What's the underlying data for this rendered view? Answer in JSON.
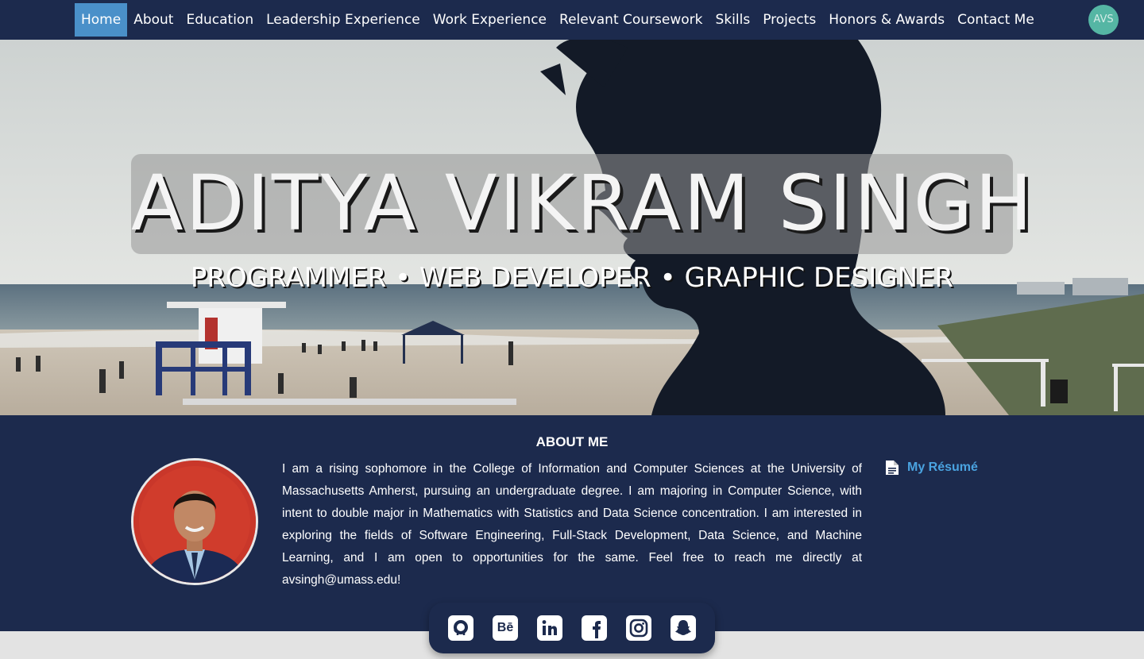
{
  "nav": {
    "items": [
      {
        "label": "Home",
        "active": true
      },
      {
        "label": "About"
      },
      {
        "label": "Education"
      },
      {
        "label": "Leadership Experience"
      },
      {
        "label": "Work Experience"
      },
      {
        "label": "Relevant Coursework"
      },
      {
        "label": "Skills"
      },
      {
        "label": "Projects"
      },
      {
        "label": "Honors & Awards"
      },
      {
        "label": "Contact Me"
      }
    ],
    "badge": "AVS"
  },
  "hero": {
    "name": "ADITYA VIKRAM SINGH",
    "tagline": "PROGRAMMER • WEB DEVELOPER • GRAPHIC DESIGNER"
  },
  "about": {
    "heading": "ABOUT ME",
    "text": "I am a rising sophomore in the College of Information and Computer Sciences at the University of Massachusetts Amherst, pursuing an undergraduate degree. I am majoring in Computer Science, with intent to double major in Mathematics with Statistics and Data Science concentration. I am interested in exploring the fields of Software Engineering, Full-Stack Development, Data Science, and Machine Learning, and I am open to opportunities for the same. Feel free to reach me directly at avsingh@umass.edu!",
    "resume_label": "My Résumé"
  },
  "social": {
    "icons": [
      "github-icon",
      "behance-icon",
      "linkedin-icon",
      "facebook-icon",
      "instagram-icon",
      "snapchat-icon"
    ],
    "behance_glyph": "Bē"
  },
  "colors": {
    "navy": "#1c2a4d",
    "active_nav": "#4a90c9",
    "link_blue": "#4aa3e0",
    "badge_teal": "#55b6a4"
  }
}
